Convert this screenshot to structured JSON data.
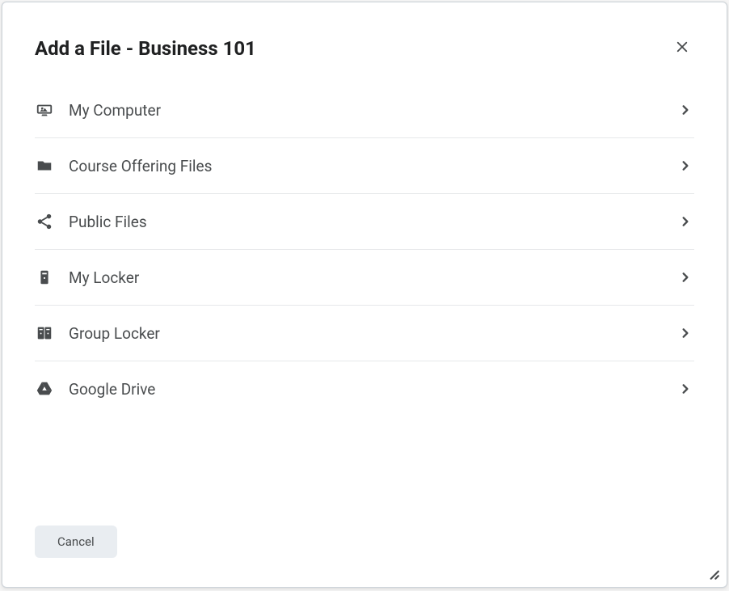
{
  "dialog": {
    "title": "Add a File - Business 101"
  },
  "sources": [
    {
      "id": "my-computer",
      "label": "My Computer",
      "icon": "computer-icon"
    },
    {
      "id": "course-offering-files",
      "label": "Course Offering Files",
      "icon": "folder-icon"
    },
    {
      "id": "public-files",
      "label": "Public Files",
      "icon": "share-icon"
    },
    {
      "id": "my-locker",
      "label": "My Locker",
      "icon": "locker-icon"
    },
    {
      "id": "group-locker",
      "label": "Group Locker",
      "icon": "group-locker-icon"
    },
    {
      "id": "google-drive",
      "label": "Google Drive",
      "icon": "google-drive-icon"
    }
  ],
  "footer": {
    "cancel_label": "Cancel"
  }
}
